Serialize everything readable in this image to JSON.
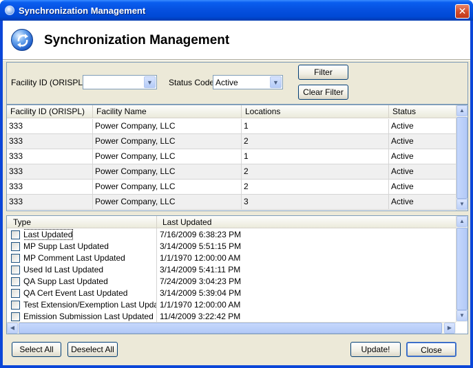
{
  "window": {
    "title": "Synchronization Management",
    "close_glyph": "✕"
  },
  "header": {
    "title": "Synchronization Management",
    "icon": "sync-logo-icon"
  },
  "filter": {
    "facility_label": "Facility ID (ORISPL)",
    "facility_value": "",
    "status_label": "Status Code",
    "status_value": "Active",
    "filter_button": "Filter",
    "clear_filter_button": "Clear Filter"
  },
  "facilities": {
    "columns": [
      "Facility ID (ORISPL)",
      "Facility Name",
      "Locations",
      "Status"
    ],
    "rows": [
      [
        "333",
        "Power Company, LLC",
        "1",
        "Active"
      ],
      [
        "333",
        "Power Company, LLC",
        "2",
        "Active"
      ],
      [
        "333",
        "Power Company, LLC",
        "1",
        "Active"
      ],
      [
        "333",
        "Power Company, LLC",
        "2",
        "Active"
      ],
      [
        "333",
        "Power Company, LLC",
        "2",
        "Active"
      ],
      [
        "333",
        "Power Company, LLC",
        "3",
        "Active"
      ]
    ]
  },
  "updates": {
    "columns": [
      "Type",
      "Last Updated"
    ],
    "rows": [
      {
        "type": "Last Updated",
        "date": "7/16/2009 6:38:23 PM",
        "checked": false
      },
      {
        "type": "MP Supp Last Updated",
        "date": "3/14/2009 5:51:15 PM",
        "checked": false
      },
      {
        "type": "MP Comment Last Updated",
        "date": "1/1/1970 12:00:00 AM",
        "checked": false
      },
      {
        "type": "Used Id Last Updated",
        "date": "3/14/2009 5:41:11 PM",
        "checked": false
      },
      {
        "type": "QA Supp Last Updated",
        "date": "7/24/2009 3:04:23 PM",
        "checked": false
      },
      {
        "type": "QA Cert Event Last Updated",
        "date": "3/14/2009 5:39:04 PM",
        "checked": false
      },
      {
        "type": "Test Extension/Exemption Last Updated",
        "date": "1/1/1970 12:00:00 AM",
        "checked": false
      },
      {
        "type": "Emission Submission Last Updated",
        "date": "11/4/2009 3:22:42 PM",
        "checked": false
      }
    ]
  },
  "footer": {
    "select_all": "Select All",
    "deselect_all": "Deselect All",
    "update": "Update!",
    "close": "Close"
  }
}
